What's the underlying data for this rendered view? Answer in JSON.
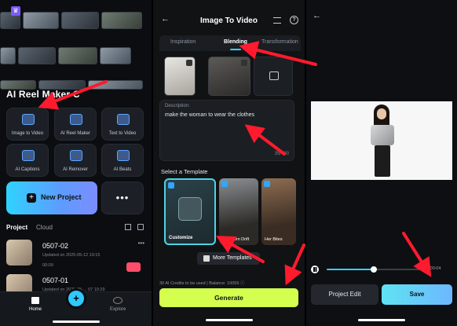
{
  "panel1": {
    "section_title": "AI Reel Maker C",
    "tools": [
      {
        "label": "Image to Video",
        "icon": "image-to-video-icon"
      },
      {
        "label": "AI Reel Maker",
        "icon": "reel-maker-icon"
      },
      {
        "label": "Text to Video",
        "icon": "text-to-video-icon"
      },
      {
        "label": "AI Captions",
        "icon": "captions-icon"
      },
      {
        "label": "AI Remover",
        "icon": "remover-icon"
      },
      {
        "label": "AI Beats",
        "icon": "beats-icon"
      }
    ],
    "new_project_label": "New Project",
    "more_label": "•••",
    "tab_project": "Project",
    "tab_cloud": "Cloud",
    "projects": [
      {
        "name": "0507-02",
        "updated": "Updated on 2025-05-12 19:15",
        "duration": "00:09"
      },
      {
        "name": "0507-01",
        "updated": "Updated on 2025-05-... 07 19:29",
        "duration": ""
      }
    ],
    "nav": {
      "home": "Home",
      "explore": "Explore",
      "plus": "+"
    }
  },
  "panel2": {
    "back": "←",
    "title": "Image To Video",
    "tabs": [
      "Inspiration",
      "Blending",
      "Transformation"
    ],
    "active_tab": "Blending",
    "description_label": "Description:",
    "description_text": "make the woman to wear the clothes",
    "char_count": "35/400",
    "select_template": "Select a Template",
    "templates": [
      "Customize",
      "Afterburn Drift",
      "Her Bites"
    ],
    "more_templates": "More Templates",
    "credits_text": "30 AI Credits to be used | Balance: 10059 ⓘ",
    "generate_label": "Generate",
    "help": "?"
  },
  "panel3": {
    "back": "←",
    "time": "00:00:04",
    "progress": 0.5,
    "project_edit_label": "Project Edit",
    "save_label": "Save"
  },
  "colors": {
    "accent_cyan": "#2fd3ff",
    "generate_green": "#d4ff4f",
    "arrow_red": "#ff1a2e"
  }
}
